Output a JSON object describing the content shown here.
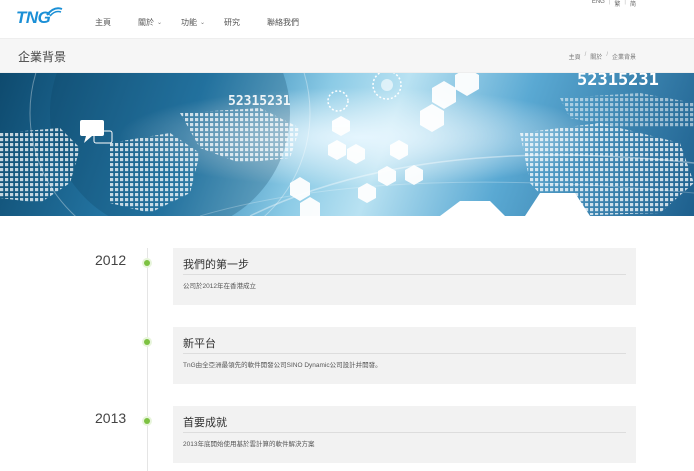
{
  "header": {
    "logo_text": "TNG",
    "nav": [
      {
        "label": "主頁",
        "dropdown": false
      },
      {
        "label": "關於",
        "dropdown": true
      },
      {
        "label": "功能",
        "dropdown": true
      },
      {
        "label": "研究",
        "dropdown": false
      },
      {
        "label": "聯絡我們",
        "dropdown": false
      }
    ],
    "languages": [
      "ENG",
      "繁",
      "简"
    ]
  },
  "titlebar": {
    "title": "企業背景",
    "breadcrumb": [
      "主頁",
      "關於",
      "企業背景"
    ]
  },
  "banner": {
    "number_left": "52315231",
    "number_right": "52315231"
  },
  "timeline": [
    {
      "year": "2012",
      "title": "我們的第一步",
      "body": "公司於2012年在香港成立"
    },
    {
      "year": "",
      "title": "新平台",
      "body": "TnG由全亞洲最領先的軟件開發公司SINO Dynamic公司設計并開發。"
    },
    {
      "year": "2013",
      "title": "首要成就",
      "body": "2013年底開始使用基於雲計算的軟件解決方案"
    }
  ],
  "colors": {
    "accent_green": "#7dc242",
    "brand_blue": "#1a8fd6"
  }
}
